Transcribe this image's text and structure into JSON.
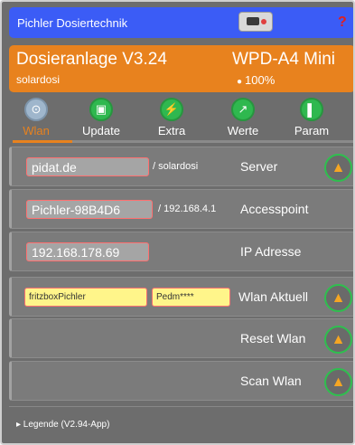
{
  "titlebar": {
    "title": "Pichler Dosiertechnik",
    "help": "?"
  },
  "header": {
    "name": "Dosieranlage V3.24",
    "sub": "solardosi",
    "model": "WPD-A4 Mini",
    "level": "100%"
  },
  "nav": [
    {
      "label": "Wlan",
      "icon": "wifi-icon",
      "glyph": "⊙",
      "active": true
    },
    {
      "label": "Update",
      "icon": "save-icon",
      "glyph": "▣",
      "active": false
    },
    {
      "label": "Extra",
      "icon": "lightning-icon",
      "glyph": "⚡",
      "active": false
    },
    {
      "label": "Werte",
      "icon": "chart-icon",
      "glyph": "↗",
      "active": false
    },
    {
      "label": "Param",
      "icon": "bars-icon",
      "glyph": "▌",
      "active": false
    }
  ],
  "rows": {
    "server": {
      "value": "pidat.de",
      "suffix": "/ solardosi",
      "label": "Server"
    },
    "accesspoint": {
      "value": "Pichler-98B4D6",
      "suffix": "/ 192.168.4.1",
      "label": "Accesspoint"
    },
    "ip": {
      "value": "192.168.178.69",
      "label": "IP Adresse"
    },
    "wlan": {
      "ssid": "fritzboxPichler",
      "password": "Pedm****",
      "label": "Wlan Aktuell"
    },
    "reset": {
      "label": "Reset Wlan"
    },
    "scan": {
      "label": "Scan Wlan"
    }
  },
  "legend": {
    "label": "▸ Legende (V2.94-App)"
  },
  "colors": {
    "accent": "#e8821e",
    "title_bg": "#3b5cf6",
    "ok": "#2fbf4f"
  }
}
